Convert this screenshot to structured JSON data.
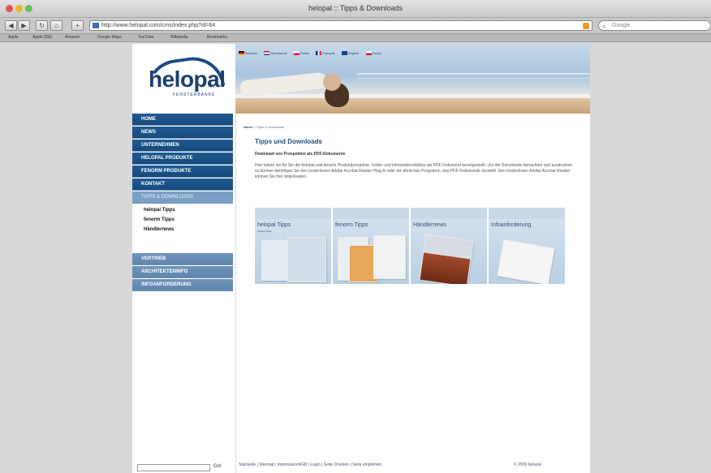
{
  "browser": {
    "window_title": "helopal :: Tipps & Downloads",
    "url": "http://www.helopal.com/cms/index.php?id=64",
    "search_placeholder": "Google",
    "bookmarks": [
      "Apple",
      "Apple (DE)",
      "Amazon",
      "Google Maps",
      "YouTube",
      "Wikipedia",
      "Bookmarks"
    ]
  },
  "site": {
    "logo_text": "helopal",
    "logo_sub": "FENSTERBÄNKE",
    "languages": [
      "Deutsch",
      "Nederlands",
      "Polski",
      "Français",
      "English",
      "Česky"
    ],
    "nav": [
      {
        "label": "HOME"
      },
      {
        "label": "NEWS"
      },
      {
        "label": "UNTERNEHMEN"
      },
      {
        "label": "HELOPAL PRODUKTE"
      },
      {
        "label": "FENORM PRODUKTE"
      },
      {
        "label": "KONTAKT"
      },
      {
        "label": "TIPPS & DOWNLOADS"
      }
    ],
    "subnav": [
      "helopal Tipps",
      "fenorm Tipps",
      "Händlernews"
    ],
    "nav_lower": [
      {
        "label": "VERTRIEB"
      },
      {
        "label": "ARCHITEKTENINFO"
      },
      {
        "label": "INFOANFORDERUNG"
      }
    ],
    "footer_search_button": "Go!"
  },
  "content": {
    "breadcrumb": {
      "home": "Home",
      "current": "» Tipps & Downloads"
    },
    "title": "Tipps und Downloads",
    "subtitle": "Download von Prospekten als PDF-Dokumente",
    "text": "Hier haben wir für Sie die helopal und fenorm Produktprospekte, Folder und Informationsblätter als PDF-Dokument bereitgestellt. Um die Dokumente betrachten und ausdrucken zu können benötigen Sie den kostenlosen Adobe Acrobat Reader Plug-In oder ein ähnliches Programm, das PDF-Dokumente darstellt. Den kostenlosen Adobe Acrobat Reader können Sie hier downloaden.",
    "downloads": [
      {
        "label": "helopal Tipps",
        "sub": "helopal Tipps"
      },
      {
        "label": "fenorm Tipps",
        "sub": ""
      },
      {
        "label": "Händlernews",
        "sub": ""
      },
      {
        "label": "Infoanforderung",
        "sub": ""
      }
    ],
    "footer_links": "Startseite | Sitemap | Impressum/AGB | Login | Seite Drucken | Seite empfehlen",
    "copyright": "© 2009 helopal"
  },
  "colors": {
    "nav_blue": "#1f5a92",
    "accent_blue": "#1f4e82",
    "nav_light": "#7a9fc4"
  }
}
